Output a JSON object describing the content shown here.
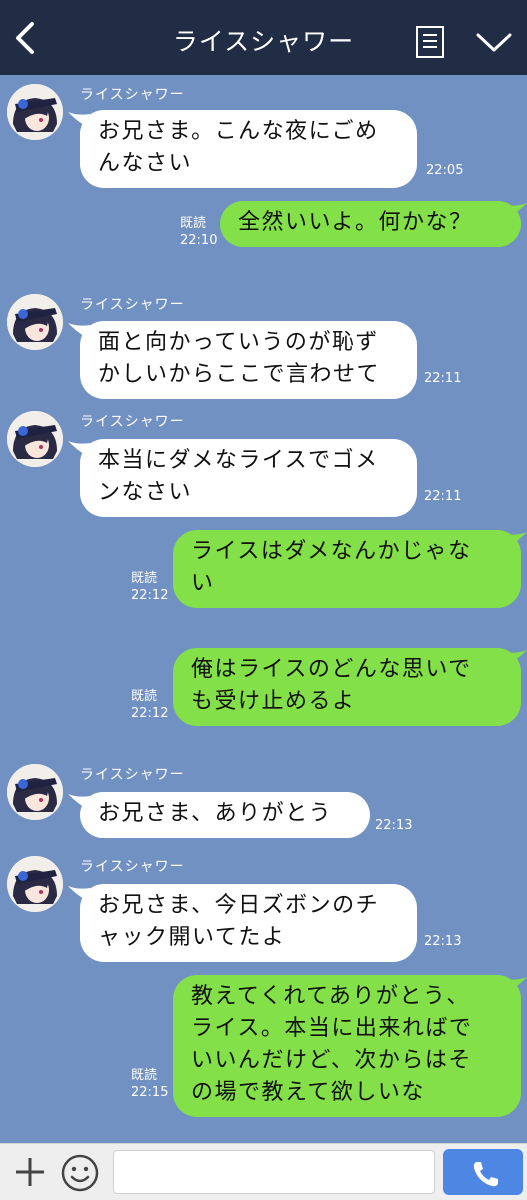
{
  "header": {
    "title": "ライスシャワー",
    "back_icon": "chevron-left-icon",
    "menu_icon": "notes-icon",
    "more_icon": "chevron-down-icon"
  },
  "colors": {
    "header_bg": "#212d44",
    "chat_bg": "#7191c2",
    "incoming_bubble": "#ffffff",
    "outgoing_bubble": "#84e048",
    "send_button": "#4e86e4"
  },
  "messages": [
    {
      "dir": "in",
      "sender": "ライスシャワー",
      "lines": [
        "お兄さま。こんな夜にごめ",
        "んなさい"
      ],
      "time": "22:05"
    },
    {
      "dir": "out",
      "lines": [
        "全然いいよ。何かな？"
      ],
      "read": "既読",
      "time": "22:10"
    },
    {
      "dir": "in",
      "sender": "ライスシャワー",
      "lines": [
        "面と向かっていうのが恥ず",
        "かしいからここで言わせて"
      ],
      "time": "22:11"
    },
    {
      "dir": "in",
      "sender": "ライスシャワー",
      "lines": [
        "本当にダメなライスでゴメ",
        "ンなさい"
      ],
      "time": "22:11"
    },
    {
      "dir": "out",
      "lines": [
        "ライスはダメなんかじゃな",
        "い"
      ],
      "read": "既読",
      "time": "22:12"
    },
    {
      "dir": "out",
      "lines": [
        "俺はライスのどんな思いで",
        "も受け止めるよ"
      ],
      "read": "既読",
      "time": "22:12"
    },
    {
      "dir": "in",
      "sender": "ライスシャワー",
      "lines": [
        "お兄さま、ありがとう"
      ],
      "time": "22:13"
    },
    {
      "dir": "in",
      "sender": "ライスシャワー",
      "lines": [
        "お兄さま、今日ズボンのチ",
        "ャック開いてたよ"
      ],
      "time": "22:13"
    },
    {
      "dir": "out",
      "lines": [
        "教えてくれてありがとう、",
        "ライス。本当に出来ればで",
        "いいんだけど、次からはそ",
        "の場で教えて欲しいな"
      ],
      "read": "既読",
      "time": "22:15"
    }
  ],
  "input_bar": {
    "plus_icon": "plus-icon",
    "emoji_icon": "smiley-icon",
    "input_value": "",
    "call_icon": "phone-icon"
  }
}
